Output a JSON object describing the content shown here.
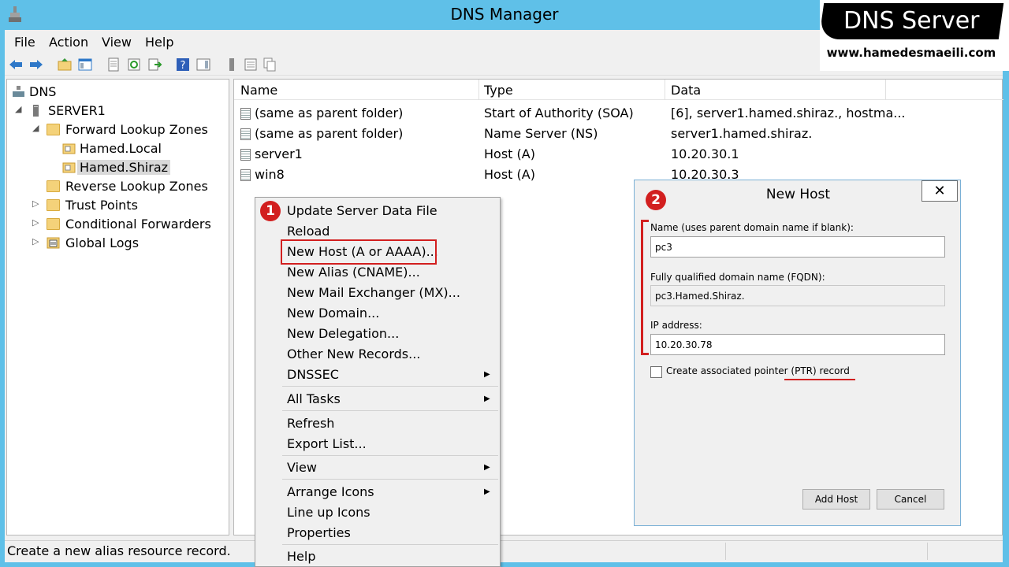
{
  "window": {
    "title": "DNS Manager"
  },
  "brand": {
    "title": "DNS Server",
    "url": "www.hamedesmaeili.com"
  },
  "menu": [
    "File",
    "Action",
    "View",
    "Help"
  ],
  "toolbar_icons": [
    "back-arrow-icon",
    "forward-arrow-icon",
    "folder-up-icon",
    "show-hide-tree-icon",
    "properties-icon",
    "refresh-icon",
    "export-list-icon",
    "help-icon",
    "action-pane-icon",
    "server-icon",
    "list-icon",
    "copy-icon"
  ],
  "tree": [
    {
      "label": "DNS",
      "icon": "dns-icon"
    },
    {
      "label": "SERVER1",
      "icon": "server-icon"
    },
    {
      "label": "Forward Lookup Zones",
      "icon": "folder-icon"
    },
    {
      "label": "Hamed.Local",
      "icon": "zone-icon"
    },
    {
      "label": "Hamed.Shiraz",
      "icon": "zone-icon",
      "selected": true
    },
    {
      "label": "Reverse Lookup Zones",
      "icon": "folder-icon"
    },
    {
      "label": "Trust Points",
      "icon": "folder-icon"
    },
    {
      "label": "Conditional Forwarders",
      "icon": "folder-icon"
    },
    {
      "label": "Global Logs",
      "icon": "log-icon"
    }
  ],
  "list": {
    "columns": [
      "Name",
      "Type",
      "Data"
    ],
    "rows": [
      {
        "name": "(same as parent folder)",
        "type": "Start of Authority (SOA)",
        "data": "[6], server1.hamed.shiraz., hostma..."
      },
      {
        "name": "(same as parent folder)",
        "type": "Name Server (NS)",
        "data": "server1.hamed.shiraz."
      },
      {
        "name": "server1",
        "type": "Host (A)",
        "data": "10.20.30.1"
      },
      {
        "name": "win8",
        "type": "Host (A)",
        "data": "10.20.30.3"
      }
    ]
  },
  "context_menu": {
    "items": [
      "Update Server Data File",
      "Reload",
      "New Host (A or AAAA)...",
      "New Alias (CNAME)...",
      "New Mail Exchanger (MX)...",
      "New Domain...",
      "New Delegation...",
      "Other New Records...",
      "DNSSEC",
      "All Tasks",
      "Refresh",
      "Export List...",
      "View",
      "Arrange Icons",
      "Line up Icons",
      "Properties",
      "Help"
    ]
  },
  "badges": {
    "one": "1",
    "two": "2"
  },
  "dialog": {
    "title": "New Host",
    "close": "✕",
    "name_label": "Name (uses parent domain name if blank):",
    "name_value": "pc3",
    "fqdn_label": "Fully qualified domain name (FQDN):",
    "fqdn_value": "pc3.Hamed.Shiraz.",
    "ip_label": "IP address:",
    "ip_value": "10.20.30.78",
    "ptr_label": "Create associated pointer (PTR) record",
    "ptr_checked": false,
    "add_button": "Add Host",
    "cancel_button": "Cancel"
  },
  "status": {
    "text": "Create a new alias resource record."
  },
  "colors": {
    "titlebar": "#5fc0e8",
    "highlight": "#d21f1f",
    "window": "#f0f0f0"
  }
}
